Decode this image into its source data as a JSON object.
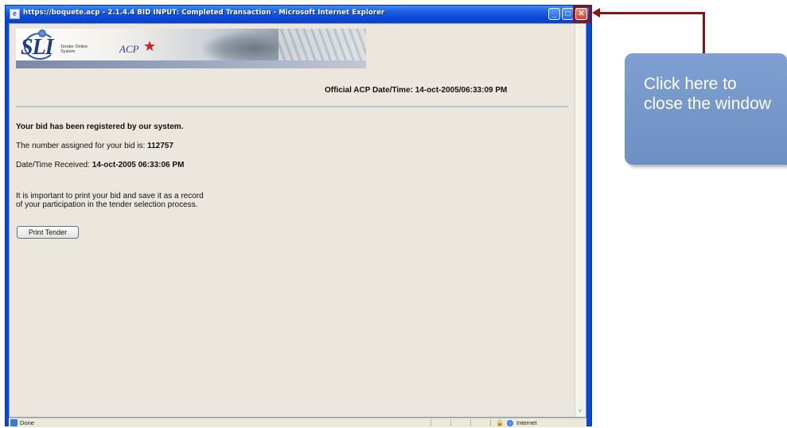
{
  "window": {
    "title": "https://boquete.acp - 2.1.4.4 BID INPUT: Completed Transaction - Microsoft Internet Explorer",
    "minimize_label": "_",
    "maximize_label": "□",
    "close_label": "✕"
  },
  "banner": {
    "logo_text": "SLI",
    "tagline": "Tender Online System",
    "acp_text": "ACP"
  },
  "page": {
    "official_datetime": "Official ACP Date/Time: 14-oct-2005/06:33:09 PM",
    "registered_text": "Your bid has been registered by our system.",
    "bid_number_label": "The number assigned for your bid is: ",
    "bid_number": "112757",
    "received_label": "Date/Time Received: ",
    "received_value": "14-oct-2005 06:33:06 PM",
    "important_line1": "It is important to print your bid and save it as a record",
    "important_line2": "of your participation in the tender selection process.",
    "print_button": "Print Tender"
  },
  "statusbar": {
    "status": "Done",
    "zone": "Internet"
  },
  "annotation": {
    "callout_text": "Click here to close the window",
    "color": "#8a1414",
    "callout_color": "#7e9fd0"
  }
}
